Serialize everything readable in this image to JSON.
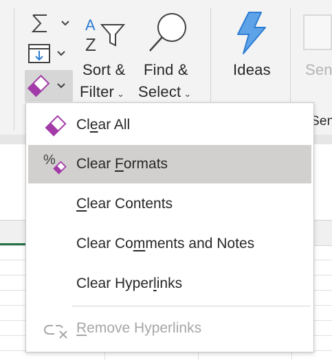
{
  "ribbon": {
    "autosum_icon": "sigma-icon",
    "fill_icon": "fill-down-icon",
    "clear_icon": "eraser-icon",
    "sort_filter": {
      "line1": "Sort &",
      "line2": "Filter",
      "icon": "sort-az-filter-icon"
    },
    "find_select": {
      "line1": "Find &",
      "line2": "Select",
      "icon": "magnifier-icon"
    },
    "ideas": {
      "label": "Ideas",
      "icon": "lightning-bolt-icon"
    },
    "sensitivity_partial": "Sen",
    "sensitivity_partial_2": "Sen"
  },
  "menu": {
    "items": [
      {
        "pre": "Cl",
        "key": "e",
        "post": "ar All",
        "icon": "eraser-icon",
        "state": "normal"
      },
      {
        "pre": "Clear ",
        "key": "F",
        "post": "ormats",
        "icon": "clear-formats-icon",
        "state": "hover"
      },
      {
        "pre": "",
        "key": "C",
        "post": "lear Contents",
        "icon": "",
        "state": "normal"
      },
      {
        "pre": "Clear Co",
        "key": "m",
        "post": "ments and Notes",
        "icon": "",
        "state": "normal"
      },
      {
        "pre": "Clear Hyper",
        "key": "l",
        "post": "inks",
        "icon": "",
        "state": "normal"
      },
      {
        "pre": "",
        "key": "R",
        "post": "emove Hyperlinks",
        "icon": "unlink-icon",
        "state": "disabled"
      }
    ]
  },
  "colors": {
    "accent_purple": "#a23aa7",
    "ideas_blue": "#2b7cd3",
    "hover_bg": "#d2d0ce",
    "excel_green": "#217346"
  }
}
